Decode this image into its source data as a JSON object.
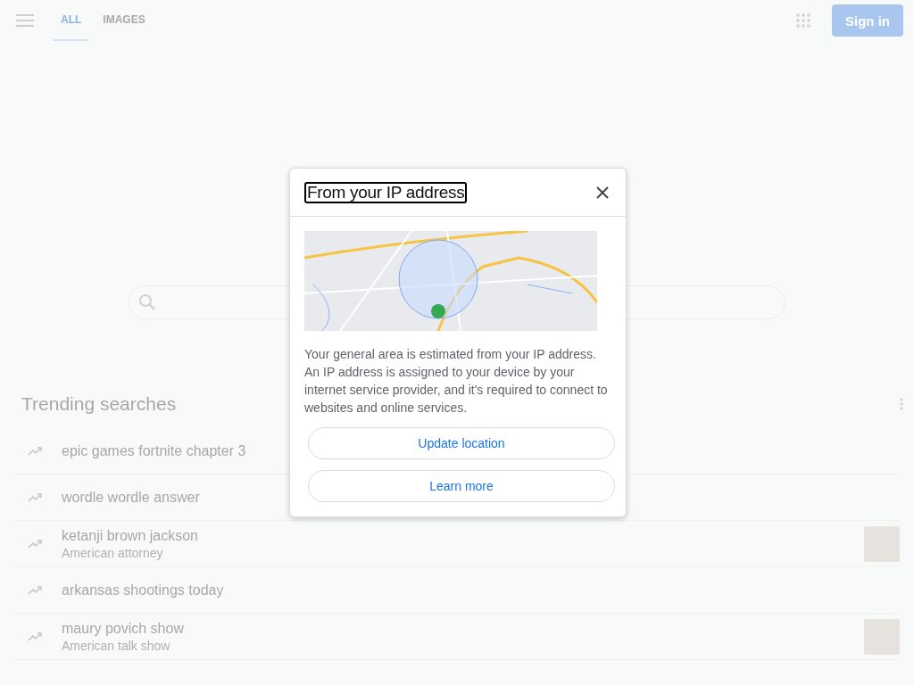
{
  "header": {
    "tabs": [
      {
        "label": "ALL",
        "selected": true
      },
      {
        "label": "IMAGES",
        "selected": false
      }
    ],
    "sign_in": "Sign in"
  },
  "trending": {
    "title": "Trending searches",
    "items": [
      {
        "title": "epic games fortnite chapter 3",
        "photo": false
      },
      {
        "title": "wordle wordle answer",
        "photo": false
      },
      {
        "title": "ketanji brown jackson",
        "subtitle": "American attorney",
        "photo": true
      },
      {
        "title": "arkansas shootings today",
        "photo": false
      },
      {
        "title": "maury povich show",
        "subtitle": "American talk show",
        "photo": true
      }
    ]
  },
  "dialog": {
    "title": "From your IP address",
    "body": "Your general area is estimated from your IP address. An IP address is assigned to your device by your internet service provider, and it's required to connect to websites and online services.",
    "buttons": [
      "Update location",
      "Learn more"
    ]
  }
}
